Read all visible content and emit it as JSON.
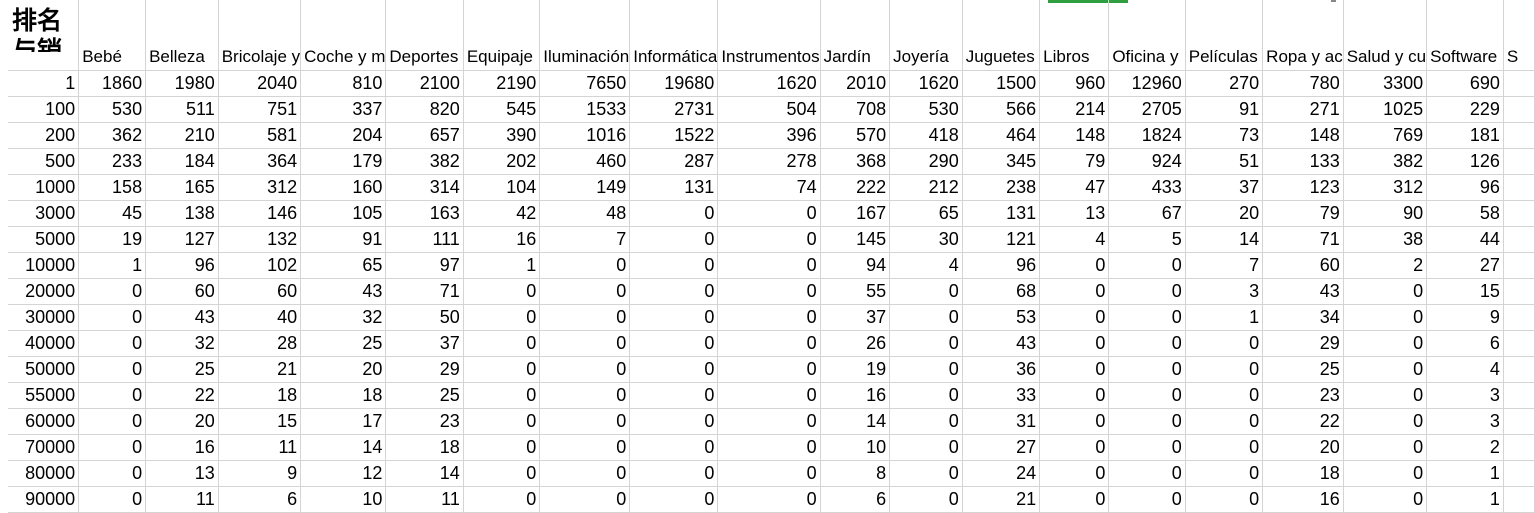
{
  "sheet": {
    "rank_header_line1": "排名",
    "rank_header_line2": "与销",
    "columns": [
      "Bebé",
      "Belleza",
      "Bricolaje y",
      "Coche y m",
      "Deportes",
      "Equipaje",
      "Iluminación",
      "Informática",
      "Instrumentos",
      "Jardín",
      "Joyería",
      "Juguetes",
      "Libros",
      "Oficina y",
      "Películas",
      "Ropa y ac",
      "Salud y cu",
      "Software",
      "S"
    ],
    "rows": [
      {
        "rank": "1",
        "values": [
          "1860",
          "1980",
          "2040",
          "810",
          "2100",
          "2190",
          "7650",
          "19680",
          "1620",
          "2010",
          "1620",
          "1500",
          "960",
          "12960",
          "270",
          "780",
          "3300",
          "690"
        ]
      },
      {
        "rank": "100",
        "values": [
          "530",
          "511",
          "751",
          "337",
          "820",
          "545",
          "1533",
          "2731",
          "504",
          "708",
          "530",
          "566",
          "214",
          "2705",
          "91",
          "271",
          "1025",
          "229"
        ]
      },
      {
        "rank": "200",
        "values": [
          "362",
          "210",
          "581",
          "204",
          "657",
          "390",
          "1016",
          "1522",
          "396",
          "570",
          "418",
          "464",
          "148",
          "1824",
          "73",
          "148",
          "769",
          "181"
        ]
      },
      {
        "rank": "500",
        "values": [
          "233",
          "184",
          "364",
          "179",
          "382",
          "202",
          "460",
          "287",
          "278",
          "368",
          "290",
          "345",
          "79",
          "924",
          "51",
          "133",
          "382",
          "126"
        ]
      },
      {
        "rank": "1000",
        "values": [
          "158",
          "165",
          "312",
          "160",
          "314",
          "104",
          "149",
          "131",
          "74",
          "222",
          "212",
          "238",
          "47",
          "433",
          "37",
          "123",
          "312",
          "96"
        ]
      },
      {
        "rank": "3000",
        "values": [
          "45",
          "138",
          "146",
          "105",
          "163",
          "42",
          "48",
          "0",
          "0",
          "167",
          "65",
          "131",
          "13",
          "67",
          "20",
          "79",
          "90",
          "58"
        ]
      },
      {
        "rank": "5000",
        "values": [
          "19",
          "127",
          "132",
          "91",
          "111",
          "16",
          "7",
          "0",
          "0",
          "145",
          "30",
          "121",
          "4",
          "5",
          "14",
          "71",
          "38",
          "44"
        ]
      },
      {
        "rank": "10000",
        "values": [
          "1",
          "96",
          "102",
          "65",
          "97",
          "1",
          "0",
          "0",
          "0",
          "94",
          "4",
          "96",
          "0",
          "0",
          "7",
          "60",
          "2",
          "27"
        ]
      },
      {
        "rank": "20000",
        "values": [
          "0",
          "60",
          "60",
          "43",
          "71",
          "0",
          "0",
          "0",
          "0",
          "55",
          "0",
          "68",
          "0",
          "0",
          "3",
          "43",
          "0",
          "15"
        ]
      },
      {
        "rank": "30000",
        "values": [
          "0",
          "43",
          "40",
          "32",
          "50",
          "0",
          "0",
          "0",
          "0",
          "37",
          "0",
          "53",
          "0",
          "0",
          "1",
          "34",
          "0",
          "9"
        ]
      },
      {
        "rank": "40000",
        "values": [
          "0",
          "32",
          "28",
          "25",
          "37",
          "0",
          "0",
          "0",
          "0",
          "26",
          "0",
          "43",
          "0",
          "0",
          "0",
          "29",
          "0",
          "6"
        ]
      },
      {
        "rank": "50000",
        "values": [
          "0",
          "25",
          "21",
          "20",
          "29",
          "0",
          "0",
          "0",
          "0",
          "19",
          "0",
          "36",
          "0",
          "0",
          "0",
          "25",
          "0",
          "4"
        ]
      },
      {
        "rank": "55000",
        "values": [
          "0",
          "22",
          "18",
          "18",
          "25",
          "0",
          "0",
          "0",
          "0",
          "16",
          "0",
          "33",
          "0",
          "0",
          "0",
          "23",
          "0",
          "3"
        ]
      },
      {
        "rank": "60000",
        "values": [
          "0",
          "20",
          "15",
          "17",
          "23",
          "0",
          "0",
          "0",
          "0",
          "14",
          "0",
          "31",
          "0",
          "0",
          "0",
          "22",
          "0",
          "3"
        ]
      },
      {
        "rank": "70000",
        "values": [
          "0",
          "16",
          "11",
          "14",
          "18",
          "0",
          "0",
          "0",
          "0",
          "10",
          "0",
          "27",
          "0",
          "0",
          "0",
          "20",
          "0",
          "2"
        ]
      },
      {
        "rank": "80000",
        "values": [
          "0",
          "13",
          "9",
          "12",
          "14",
          "0",
          "0",
          "0",
          "0",
          "8",
          "0",
          "24",
          "0",
          "0",
          "0",
          "18",
          "0",
          "1"
        ]
      },
      {
        "rank": "90000",
        "values": [
          "0",
          "11",
          "6",
          "10",
          "11",
          "0",
          "0",
          "0",
          "0",
          "6",
          "0",
          "21",
          "0",
          "0",
          "0",
          "16",
          "0",
          "1"
        ]
      }
    ]
  }
}
